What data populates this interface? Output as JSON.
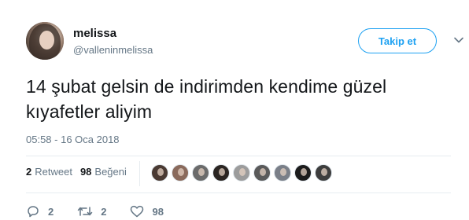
{
  "user": {
    "name": "melissa",
    "handle": "@valleninmelissa"
  },
  "follow_button": {
    "label": "Takip et"
  },
  "tweet": {
    "text_line1": "14 şubat gelsin de indirimden kendime güzel",
    "text_line2": "kıyafetler aliyim",
    "timestamp": "05:58 - 16 Oca 2018"
  },
  "stats": {
    "retweets_count": "2",
    "retweets_label": "Retweet",
    "likes_count": "98",
    "likes_label": "Beğeni"
  },
  "likers": [
    {
      "icon": "liker-avatar-1",
      "color": "#4a3a33"
    },
    {
      "icon": "liker-avatar-2",
      "color": "#8a6a5c"
    },
    {
      "icon": "liker-avatar-3",
      "color": "#6b6b6b"
    },
    {
      "icon": "liker-avatar-4",
      "color": "#2b2522"
    },
    {
      "icon": "liker-avatar-5",
      "color": "#9c9c9c"
    },
    {
      "icon": "liker-avatar-6",
      "color": "#5a5a5a"
    },
    {
      "icon": "liker-avatar-7",
      "color": "#7a7f88"
    },
    {
      "icon": "liker-avatar-8",
      "color": "#1c1c1c"
    },
    {
      "icon": "liker-avatar-9",
      "color": "#3d3d3d"
    }
  ],
  "actions": {
    "reply_count": "2",
    "retweet_count": "2",
    "like_count": "98"
  },
  "colors": {
    "accent": "#1da1f2",
    "muted": "#657786",
    "text": "#14171a",
    "divider": "#e6ecf0"
  }
}
